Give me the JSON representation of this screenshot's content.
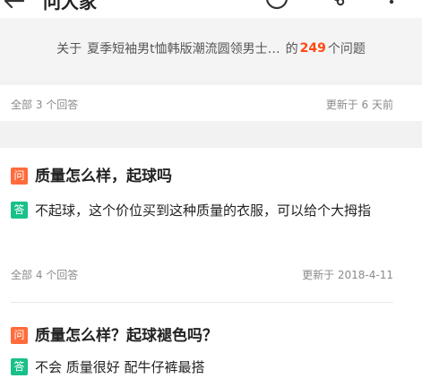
{
  "header": {
    "title": "问大家",
    "icons": [
      "back-icon",
      "ring-icon",
      "share-icon",
      "more-icon"
    ]
  },
  "summary": {
    "prefix": "关于",
    "product": "夏季短袖男t恤韩版潮流圆领男士…",
    "mid": "的",
    "count": "249",
    "suffix": "个问题"
  },
  "sections": [
    {
      "meta_left": "全部 3 个回答",
      "meta_right": "更新于 6 天前"
    },
    {
      "question_badge": "问",
      "question": "质量怎么样，起球吗",
      "answer_badge": "答",
      "answer": "不起球，这个价位买到这种质量的衣服，可以给个大拇指",
      "meta_left": "全部 4 个回答",
      "meta_right": "更新于 2018-4-11"
    },
    {
      "question_badge": "问",
      "question": "质量怎么样？起球褪色吗？",
      "answer_badge": "答",
      "answer": "不会 质量很好 配牛仔裤最搭"
    }
  ],
  "colors": {
    "accent": "#ff4a12",
    "question_badge": "#ff6b3a",
    "answer_badge": "#19c08a"
  }
}
